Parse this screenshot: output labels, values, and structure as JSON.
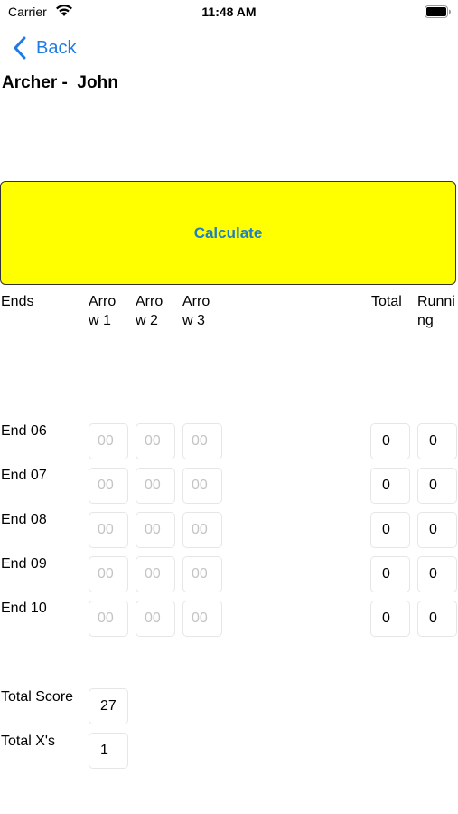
{
  "status_bar": {
    "carrier": "Carrier",
    "time": "11:48 AM"
  },
  "nav": {
    "back_label": "Back",
    "accent_color": "#1e7be6"
  },
  "archer_title": "Archer -  John",
  "calculate_button": {
    "label": "Calculate",
    "background": "#ffff00",
    "text_color": "#1f7fc2"
  },
  "headers": {
    "ends": "Ends",
    "arrow1": "Arrow 1",
    "arrow2": "Arrow 2",
    "arrow3": "Arrow 3",
    "total": "Total",
    "running": "Running"
  },
  "arrow_placeholder": "00",
  "ends": [
    {
      "label": "End 06",
      "total": "0",
      "running": "0"
    },
    {
      "label": "End 07",
      "total": "0",
      "running": "0"
    },
    {
      "label": "End 08",
      "total": "0",
      "running": "0"
    },
    {
      "label": "End 09",
      "total": "0",
      "running": "0"
    },
    {
      "label": "End 10",
      "total": "0",
      "running": "0"
    }
  ],
  "summary": {
    "total_score_label": "Total Score",
    "total_score_value": "27",
    "total_x_label": "Total X's",
    "total_x_value": "1"
  }
}
